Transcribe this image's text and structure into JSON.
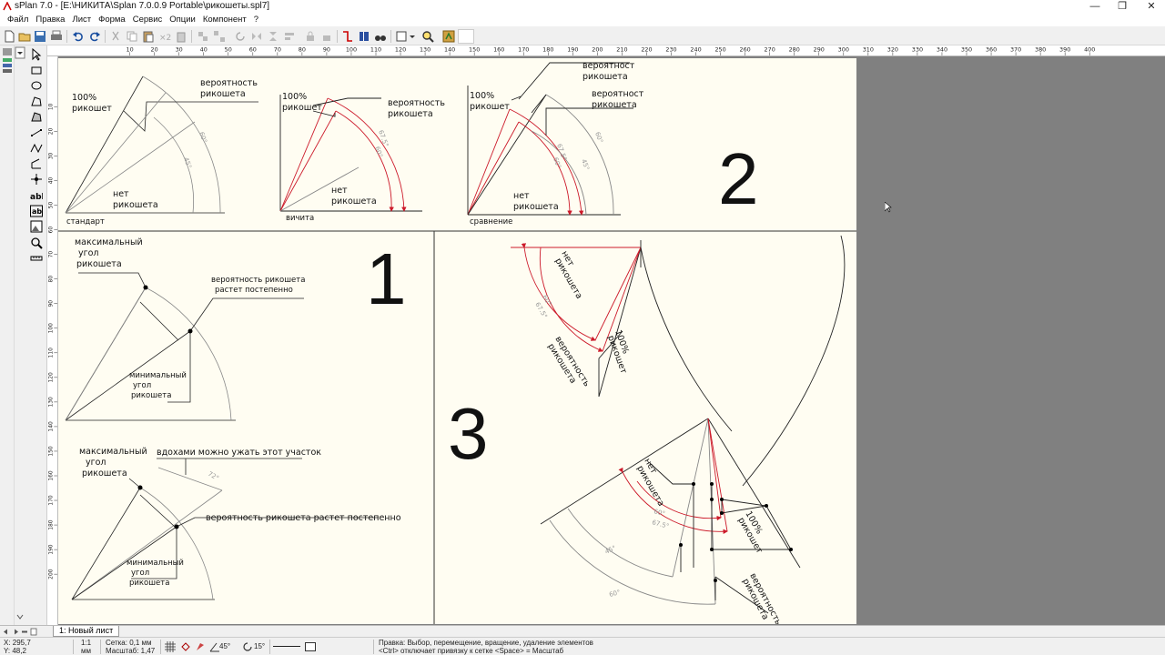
{
  "window": {
    "title": "sPlan 7.0 - [E:\\НИКИТА\\Splan 7.0.0.9 Portable\\рикошеты.spl7]",
    "minimize": "—",
    "maximize": "❐",
    "close": "✕"
  },
  "menu": [
    "Файл",
    "Правка",
    "Лист",
    "Форма",
    "Сервис",
    "Опции",
    "Компонент",
    "?"
  ],
  "ruler": {
    "h": [
      "10",
      "20",
      "30",
      "40",
      "50",
      "60",
      "70",
      "80",
      "90",
      "100",
      "110",
      "120",
      "130",
      "140",
      "150",
      "160",
      "170",
      "180",
      "190",
      "200",
      "210",
      "220",
      "230",
      "240",
      "250",
      "260",
      "270",
      "280",
      "290",
      "300",
      "310",
      "320",
      "330",
      "340",
      "350",
      "360",
      "370",
      "380",
      "390",
      "400"
    ],
    "v": [
      "10",
      "20",
      "30",
      "40",
      "50",
      "60",
      "70",
      "80",
      "90",
      "100",
      "110",
      "120",
      "130",
      "140",
      "150",
      "160",
      "170",
      "180",
      "190",
      "200"
    ]
  },
  "drawing": {
    "big_labels": {
      "one": "1",
      "two": "2",
      "three": "3"
    },
    "fig_standard": {
      "l100": "100%",
      "lrik": "рикошет",
      "prob1": "вероятность",
      "prob2": "рикошета",
      "no1": "нет",
      "no2": "рикошета",
      "a60": "60°",
      "a45": "45°",
      "caption": "стандарт"
    },
    "fig_vichita": {
      "l100": "100%",
      "lrik": "рикошет",
      "prob1": "вероятность",
      "prob2": "рикошета",
      "no1": "нет",
      "no2": "рикошета",
      "a675": "67.5°",
      "a60": "60°",
      "caption": "вичита"
    },
    "fig_compare": {
      "prob1": "вероятност",
      "prob2": "рикошета",
      "prob3": "вероятност",
      "prob4": "рикошета",
      "l100": "100%",
      "lrik": "рикошет",
      "no1": "нет",
      "no2": "рикошета",
      "a675": "67.5°",
      "a60": "60°",
      "a45": "45°",
      "a60b": "60°",
      "caption": "сравнение"
    },
    "fig_max1": {
      "max1": "максимальный",
      "max2": "угол",
      "max3": "рикошета",
      "prob1": "вероятность рикошета",
      "prob2": "растет постепенно",
      "min1": "минимальный",
      "min2": "угол",
      "min3": "рикошета"
    },
    "fig_max2": {
      "max1": "максимальный",
      "max2": "угол",
      "max3": "рикошета",
      "note": "вдохами можно ужать этот участок",
      "prob": "вероятность рикошета растет постепенно",
      "min1": "минимальный",
      "min2": "угол",
      "min3": "рикошета",
      "a72": "72°"
    },
    "fig3_top": {
      "no1": "нет",
      "no2": "рикошета",
      "a60": "60°",
      "a675": "67.5°",
      "l100": "100%",
      "lrik": "рикошет",
      "prob1": "вероятность",
      "prob2": "рикошета"
    },
    "fig3_bottom": {
      "no1": "нет",
      "no2": "рикошета",
      "a60": "60°",
      "a675": "67.5°",
      "l100": "100%",
      "lrik": "рикошет",
      "prob1": "вероятность",
      "prob2": "рикошета",
      "a45": "45°",
      "a60b": "60°"
    }
  },
  "tab": "1: Новый лист",
  "status": {
    "x": "X: 295,7",
    "y": "Y: 48,2",
    "scale_ratio": "1:1",
    "unit": "мм",
    "grid": "Сетка: 0,1 мм",
    "zoom": "Масштаб:   1,47",
    "angle1": "45°",
    "angle2": "15°",
    "hint1": "Правка: Выбор, перемещение, вращение, удаление элементов",
    "hint2": "<Ctrl> отключает привязку к сетке <Space> = Масштаб"
  },
  "colors": {
    "accent_red": "#cc1a2a",
    "sheet": "#fffdf2",
    "workspace": "#808080"
  }
}
